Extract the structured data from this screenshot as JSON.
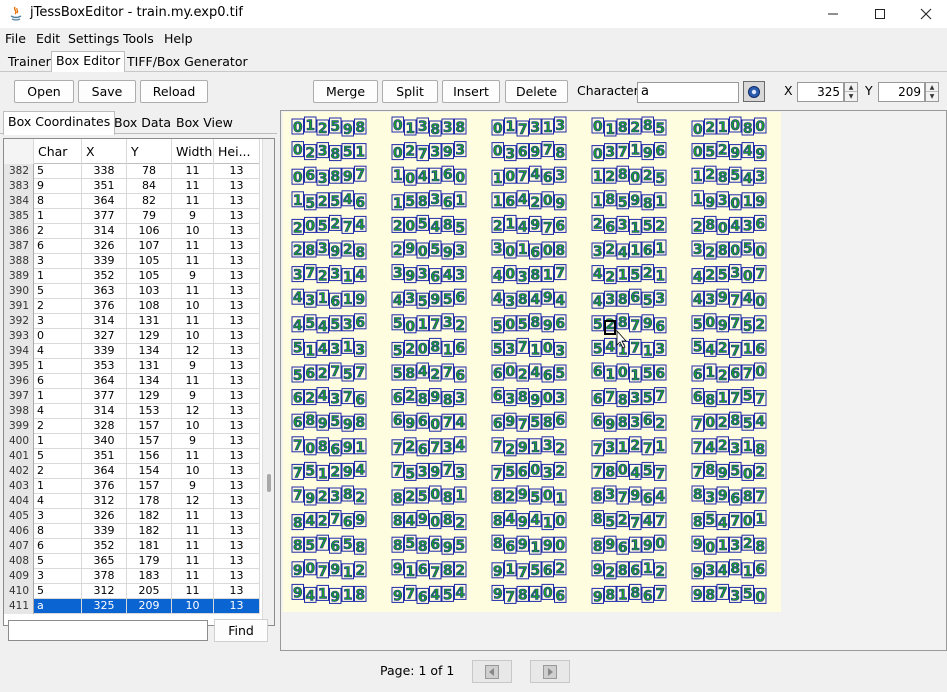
{
  "window": {
    "title": "jTessBoxEditor - train.my.exp0.tif",
    "minimize": "—",
    "maximize": "☐",
    "close": "✕"
  },
  "menu": [
    "File",
    "Edit",
    "Settings",
    "Tools",
    "Help"
  ],
  "main_tabs": [
    "Trainer",
    "Box Editor",
    "TIFF/Box Generator"
  ],
  "toolbar": {
    "open": "Open",
    "save": "Save",
    "reload": "Reload",
    "merge": "Merge",
    "split": "Split",
    "insert": "Insert",
    "delete": "Delete",
    "character_label": "Character",
    "character_value": "a",
    "x_label": "X",
    "x_value": "325",
    "y_label": "Y",
    "y_value": "209"
  },
  "left_tabs": [
    "Box Coordinates",
    "Box Data",
    "Box View"
  ],
  "table": {
    "headers": [
      "Char",
      "X",
      "Y",
      "Width",
      "Hei..."
    ],
    "rows": [
      [
        "382",
        "5",
        "338",
        "78",
        "11",
        "13"
      ],
      [
        "383",
        "9",
        "351",
        "84",
        "11",
        "13"
      ],
      [
        "384",
        "8",
        "364",
        "82",
        "11",
        "13"
      ],
      [
        "385",
        "1",
        "377",
        "79",
        "9",
        "13"
      ],
      [
        "386",
        "2",
        "314",
        "106",
        "10",
        "13"
      ],
      [
        "387",
        "6",
        "326",
        "107",
        "11",
        "13"
      ],
      [
        "388",
        "3",
        "339",
        "105",
        "11",
        "13"
      ],
      [
        "389",
        "1",
        "352",
        "105",
        "9",
        "13"
      ],
      [
        "390",
        "5",
        "363",
        "103",
        "11",
        "13"
      ],
      [
        "391",
        "2",
        "376",
        "108",
        "10",
        "13"
      ],
      [
        "392",
        "3",
        "314",
        "131",
        "11",
        "13"
      ],
      [
        "393",
        "0",
        "327",
        "129",
        "10",
        "13"
      ],
      [
        "394",
        "4",
        "339",
        "134",
        "12",
        "13"
      ],
      [
        "395",
        "1",
        "353",
        "131",
        "9",
        "13"
      ],
      [
        "396",
        "6",
        "364",
        "134",
        "11",
        "13"
      ],
      [
        "397",
        "1",
        "377",
        "129",
        "9",
        "13"
      ],
      [
        "398",
        "4",
        "314",
        "153",
        "12",
        "13"
      ],
      [
        "399",
        "2",
        "328",
        "157",
        "10",
        "13"
      ],
      [
        "400",
        "1",
        "340",
        "157",
        "9",
        "13"
      ],
      [
        "401",
        "5",
        "351",
        "156",
        "11",
        "13"
      ],
      [
        "402",
        "2",
        "364",
        "154",
        "10",
        "13"
      ],
      [
        "403",
        "1",
        "376",
        "157",
        "9",
        "13"
      ],
      [
        "404",
        "4",
        "312",
        "178",
        "12",
        "13"
      ],
      [
        "405",
        "3",
        "326",
        "182",
        "11",
        "13"
      ],
      [
        "406",
        "8",
        "339",
        "182",
        "11",
        "13"
      ],
      [
        "407",
        "6",
        "352",
        "181",
        "11",
        "13"
      ],
      [
        "408",
        "5",
        "365",
        "179",
        "11",
        "13"
      ],
      [
        "409",
        "3",
        "378",
        "183",
        "11",
        "13"
      ],
      [
        "410",
        "5",
        "312",
        "205",
        "11",
        "13"
      ],
      [
        "411",
        "a",
        "325",
        "209",
        "10",
        "13"
      ]
    ],
    "selected_index": 29
  },
  "find": {
    "value": "",
    "button": "Find"
  },
  "image_rows": [
    [
      "012598",
      "013838",
      "017313",
      "018285",
      "021080"
    ],
    [
      "023851",
      "027393",
      "036978",
      "037196",
      "052949"
    ],
    [
      "063897",
      "104160",
      "107463",
      "128025",
      "128543"
    ],
    [
      "152546",
      "158361",
      "164209",
      "185981",
      "193019"
    ],
    [
      "205274",
      "205485",
      "214976",
      "263152",
      "280436"
    ],
    [
      "283928",
      "290593",
      "301608",
      "324161",
      "328050"
    ],
    [
      "372314",
      "393643",
      "403817",
      "421521",
      "425307"
    ],
    [
      "431619",
      "435956",
      "438494",
      "438653",
      "439740"
    ],
    [
      "454536",
      "501732",
      "505896",
      "528796",
      "509752"
    ],
    [
      "514313",
      "520816",
      "537103",
      "541713",
      "542716"
    ],
    [
      "562757",
      "584276",
      "602465",
      "610156",
      "612670"
    ],
    [
      "624376",
      "628983",
      "638903",
      "678357",
      "681757"
    ],
    [
      "689598",
      "696074",
      "697586",
      "698362",
      "702854"
    ],
    [
      "708691",
      "726734",
      "729132",
      "731271",
      "742318"
    ],
    [
      "751294",
      "753973",
      "756032",
      "780457",
      "789502"
    ],
    [
      "792382",
      "825081",
      "829501",
      "837964",
      "839687"
    ],
    [
      "842769",
      "849082",
      "849410",
      "852747",
      "854701"
    ],
    [
      "857658",
      "858695",
      "869190",
      "896190",
      "901328"
    ],
    [
      "907912",
      "916782",
      "917562",
      "928612",
      "934816"
    ],
    [
      "941918",
      "976454",
      "978406",
      "981867",
      "987350"
    ]
  ],
  "footer": {
    "page_label": "Page: 1 of 1"
  },
  "colors": {
    "canvas_bg": "#fffde0",
    "glyph_fill": "#1f9a2c",
    "box_stroke": "#1f2aa8",
    "selected_row": "#0a64d2"
  }
}
